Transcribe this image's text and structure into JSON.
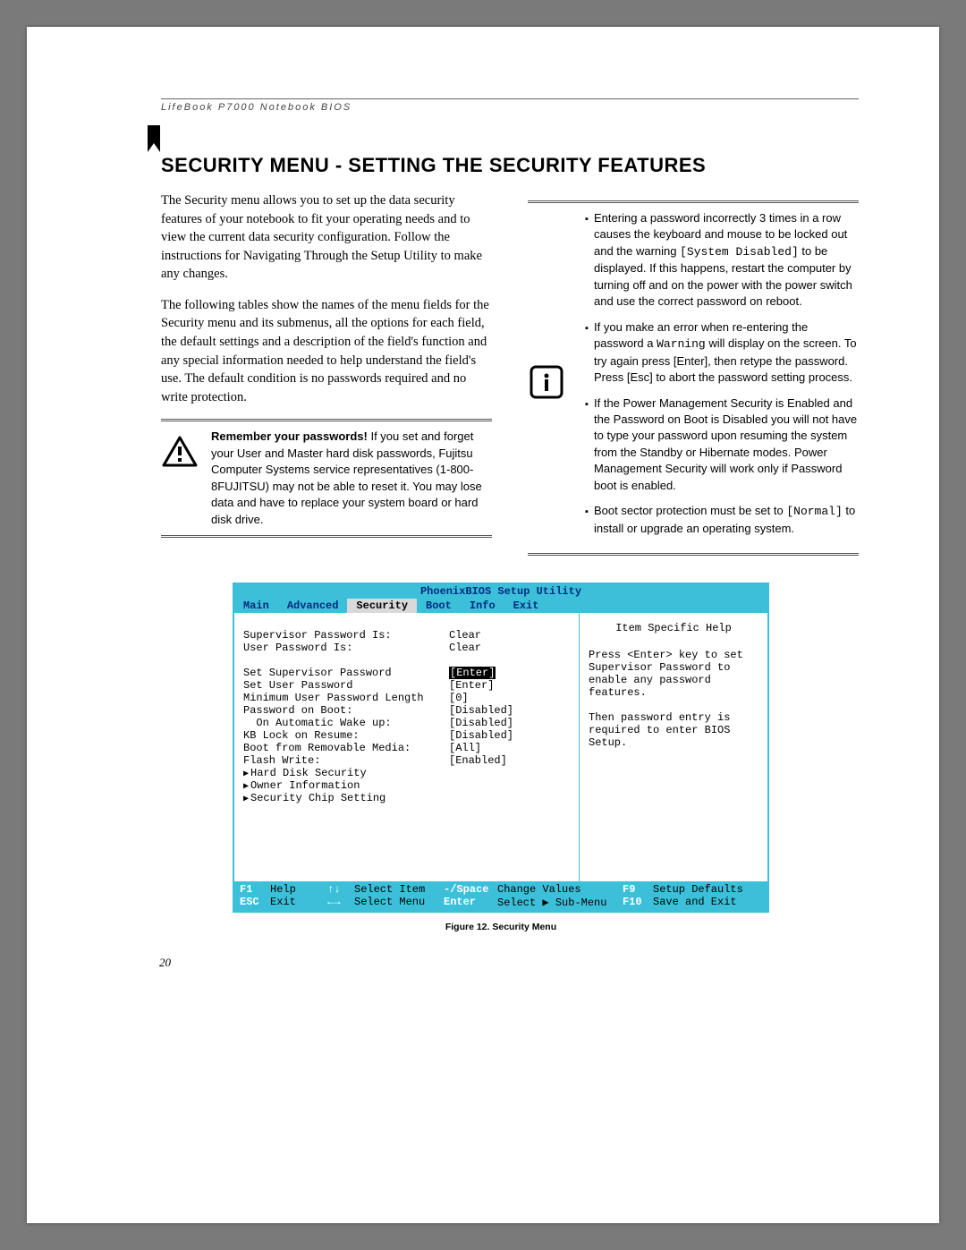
{
  "header": {
    "running_head": "LifeBook P7000 Notebook BIOS"
  },
  "title": "SECURITY MENU - SETTING THE SECURITY FEATURES",
  "body": {
    "para1": "The Security menu allows you to set up the data security features of your notebook to fit your operating needs and to view the current data security configuration. Follow the instructions for Navigating Through the Setup Utility to make any changes.",
    "para2": "The following tables show the names of the menu fields for the Security menu and its submenus, all the options for each field, the default settings and a description of the field's function and any special information needed to help understand the field's use. The default condition is no passwords required and no write protection."
  },
  "warning_box": {
    "lead": "Remember your passwords!",
    "text": " If you set and forget your User and Master hard disk passwords, Fujitsu Computer Systems service representatives (1-800-8FUJITSU) may not be able to reset it. You may lose data and have to replace your system board or hard disk drive."
  },
  "info_box": {
    "items": [
      {
        "pre": "Entering a password incorrectly 3 times in a row causes the keyboard and mouse to be locked out and the warning ",
        "code": "[System Disabled]",
        "post": " to be displayed. If this happens, restart the computer by turning off and on the power with the power switch and use the correct password on reboot."
      },
      {
        "pre": "If you make an error when re-entering the password a ",
        "code": "Warning",
        "post": " will display on the screen. To try again press [Enter], then retype the password. Press [Esc] to abort the password setting process."
      },
      {
        "pre": "If the Power Management Security is Enabled and the Password on Boot is Disabled you will not have to type your password upon resuming the system from the Standby or Hibernate modes. Power Management Security will work only if Password boot is enabled.",
        "code": "",
        "post": ""
      },
      {
        "pre": "Boot sector protection must be set to ",
        "code": "[Normal]",
        "post": " to install or upgrade an operating system."
      }
    ]
  },
  "bios": {
    "title": "PhoenixBIOS Setup Utility",
    "tabs": [
      "Main",
      "Advanced",
      "Security",
      "Boot",
      "Info",
      "Exit"
    ],
    "active_tab": 2,
    "help_title": "Item Specific Help",
    "help_text": "Press <Enter> key to set Supervisor Password to enable any password features.\n\nThen password entry is required to enter BIOS Setup.",
    "rows": [
      {
        "label": "Supervisor Password Is:",
        "value": "Clear",
        "indent": 0
      },
      {
        "label": "User Password Is:",
        "value": "Clear",
        "indent": 0
      },
      {
        "blank": true
      },
      {
        "label": "Set Supervisor Password",
        "value": "[Enter]",
        "indent": 0,
        "hl": true
      },
      {
        "label": "Set User Password",
        "value": "[Enter]",
        "indent": 0
      },
      {
        "label": "Minimum User Password Length",
        "value": "[0]",
        "indent": 0
      },
      {
        "label": "Password on Boot:",
        "value": "[Disabled]",
        "indent": 0
      },
      {
        "label": "On Automatic Wake up:",
        "value": "[Disabled]",
        "indent": 1
      },
      {
        "label": "KB Lock on Resume:",
        "value": "[Disabled]",
        "indent": 0
      },
      {
        "label": "Boot from Removable Media:",
        "value": "[All]",
        "indent": 0
      },
      {
        "label": "Flash Write:",
        "value": "[Enabled]",
        "indent": 0
      },
      {
        "label": "Hard Disk Security",
        "sub": true
      },
      {
        "label": "Owner Information",
        "sub": true
      },
      {
        "label": "Security Chip Setting",
        "sub": true
      }
    ],
    "footer": {
      "f1": "F1",
      "f1l": "Help",
      "ud": "↑↓",
      "udl": "Select Item",
      "sp": "-/Space",
      "spl": "Change Values",
      "f9": "F9",
      "f9l": "Setup Defaults",
      "esc": "ESC",
      "escl": "Exit",
      "lr": "←→",
      "lrl": "Select Menu",
      "en": "Enter",
      "enl": "Select ▶ Sub-Menu",
      "f10": "F10",
      "f10l": "Save and Exit"
    }
  },
  "figure_caption": "Figure 12.  Security Menu",
  "page_number": "20"
}
